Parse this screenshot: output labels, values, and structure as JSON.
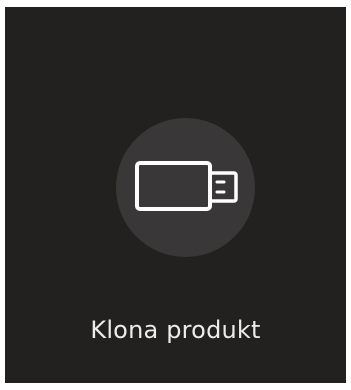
{
  "card": {
    "label": "Klona produkt",
    "icon": "usb-drive-icon"
  },
  "colors": {
    "page_border": "#ffffff",
    "panel_background": "#232020",
    "icon_circle": "#393737",
    "icon_stroke": "#ffffff",
    "label_text": "#ececec"
  }
}
